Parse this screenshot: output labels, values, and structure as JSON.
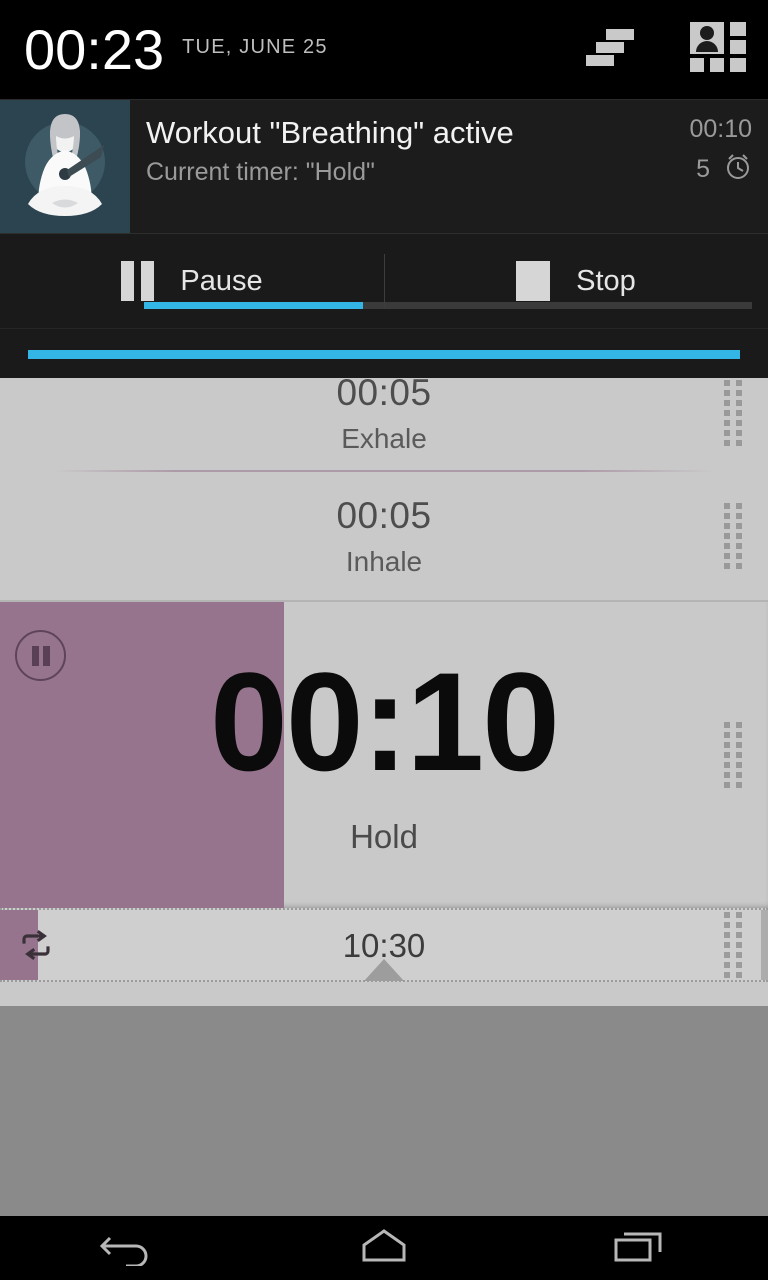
{
  "status_bar": {
    "time": "00:23",
    "date": "TUE, JUNE 25",
    "icons": [
      "clear-all-icon",
      "quick-settings-icon"
    ]
  },
  "notification": {
    "title": "Workout \"Breathing\" active",
    "subtitle": "Current timer: \"Hold\"",
    "chronometer": "00:10",
    "repeat_count": "5",
    "alarm_icon": "alarm-clock-icon",
    "thumbnail_icon": "meditation-timer-icon",
    "progress_percent": 36,
    "progress_color": "#33b5e5",
    "actions": [
      {
        "label": "Pause",
        "icon": "pause-icon"
      },
      {
        "label": "Stop",
        "icon": "stop-icon"
      }
    ],
    "shade_handle_color": "#33b5e5"
  },
  "app": {
    "accent_color": "#96748e",
    "list_background": "#c9c9c9",
    "timers": [
      {
        "time": "00:05",
        "label": "Exhale",
        "progress_percent": 0,
        "state": "pending",
        "clipped": true
      },
      {
        "time": "00:05",
        "label": "Inhale",
        "progress_percent": 0,
        "state": "pending",
        "clipped": false
      }
    ],
    "active_timer": {
      "time": "00:10",
      "label": "Hold",
      "progress_percent": 37,
      "state": "running",
      "icon": "pause-circle-icon"
    },
    "total_row": {
      "total_time": "10:30",
      "icon": "repeat-icon",
      "progress_percent": 5,
      "caret": "caret-down-icon"
    }
  },
  "nav_bar": {
    "buttons": [
      {
        "name": "back",
        "icon": "back-arrow-icon"
      },
      {
        "name": "home",
        "icon": "home-icon"
      },
      {
        "name": "recents",
        "icon": "recent-apps-icon"
      }
    ]
  }
}
